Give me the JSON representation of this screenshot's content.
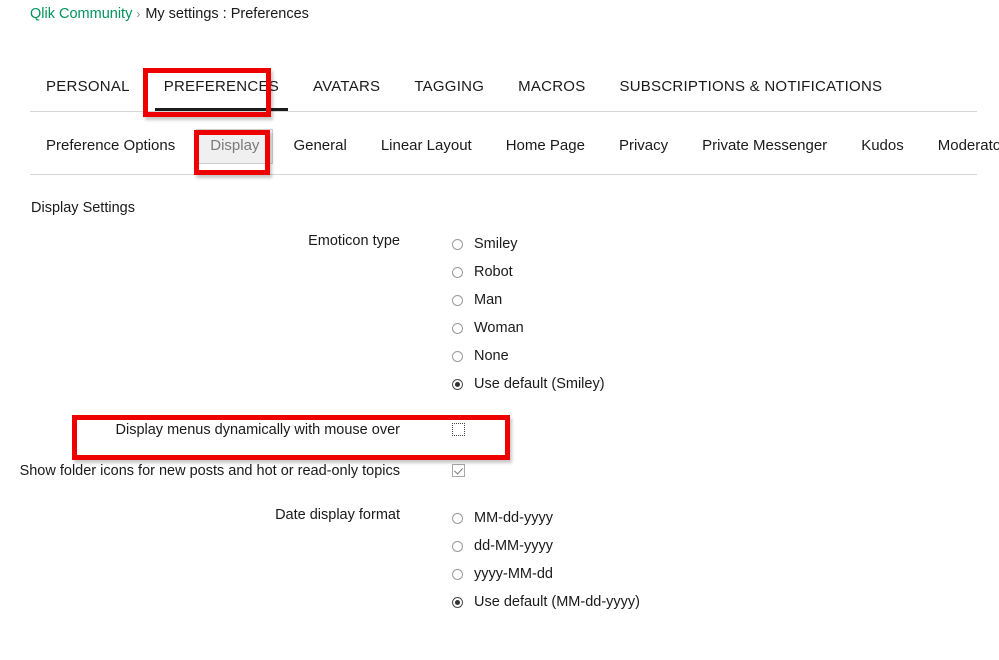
{
  "breadcrumb": {
    "root": "Qlik Community",
    "separator": "›",
    "current": "My settings : Preferences"
  },
  "main_tabs": [
    {
      "label": "PERSONAL",
      "active": false
    },
    {
      "label": "PREFERENCES",
      "active": true
    },
    {
      "label": "AVATARS",
      "active": false
    },
    {
      "label": "TAGGING",
      "active": false
    },
    {
      "label": "MACROS",
      "active": false
    },
    {
      "label": "SUBSCRIPTIONS & NOTIFICATIONS",
      "active": false
    }
  ],
  "sub_tabs": [
    {
      "label": "Preference Options",
      "selected": false
    },
    {
      "label": "Display",
      "selected": true
    },
    {
      "label": "General",
      "selected": false
    },
    {
      "label": "Linear Layout",
      "selected": false
    },
    {
      "label": "Home Page",
      "selected": false
    },
    {
      "label": "Privacy",
      "selected": false
    },
    {
      "label": "Private Messenger",
      "selected": false
    },
    {
      "label": "Kudos",
      "selected": false
    },
    {
      "label": "Moderator",
      "selected": false
    }
  ],
  "section": {
    "title": "Display Settings"
  },
  "fields": {
    "emoticon": {
      "label": "Emoticon type",
      "options": [
        {
          "label": "Smiley",
          "checked": false
        },
        {
          "label": "Robot",
          "checked": false
        },
        {
          "label": "Man",
          "checked": false
        },
        {
          "label": "Woman",
          "checked": false
        },
        {
          "label": "None",
          "checked": false
        },
        {
          "label": "Use default (Smiley)",
          "checked": true
        }
      ]
    },
    "dynamic_menus": {
      "label": "Display menus dynamically with mouse over",
      "checked": false,
      "focused": true
    },
    "folder_icons": {
      "label": "Show folder icons for new posts and hot or read-only topics",
      "checked": true,
      "focused": false
    },
    "date_format": {
      "label": "Date display format",
      "options": [
        {
          "label": "MM-dd-yyyy",
          "checked": false
        },
        {
          "label": "dd-MM-yyyy",
          "checked": false
        },
        {
          "label": "yyyy-MM-dd",
          "checked": false
        },
        {
          "label": "Use default (MM-dd-yyyy)",
          "checked": true
        }
      ]
    }
  },
  "annotations": {
    "color": "#EE0000",
    "boxes": [
      {
        "target": "PREFERENCES"
      },
      {
        "target": "Display"
      },
      {
        "target": "Display menus dynamically with mouse over"
      }
    ]
  }
}
